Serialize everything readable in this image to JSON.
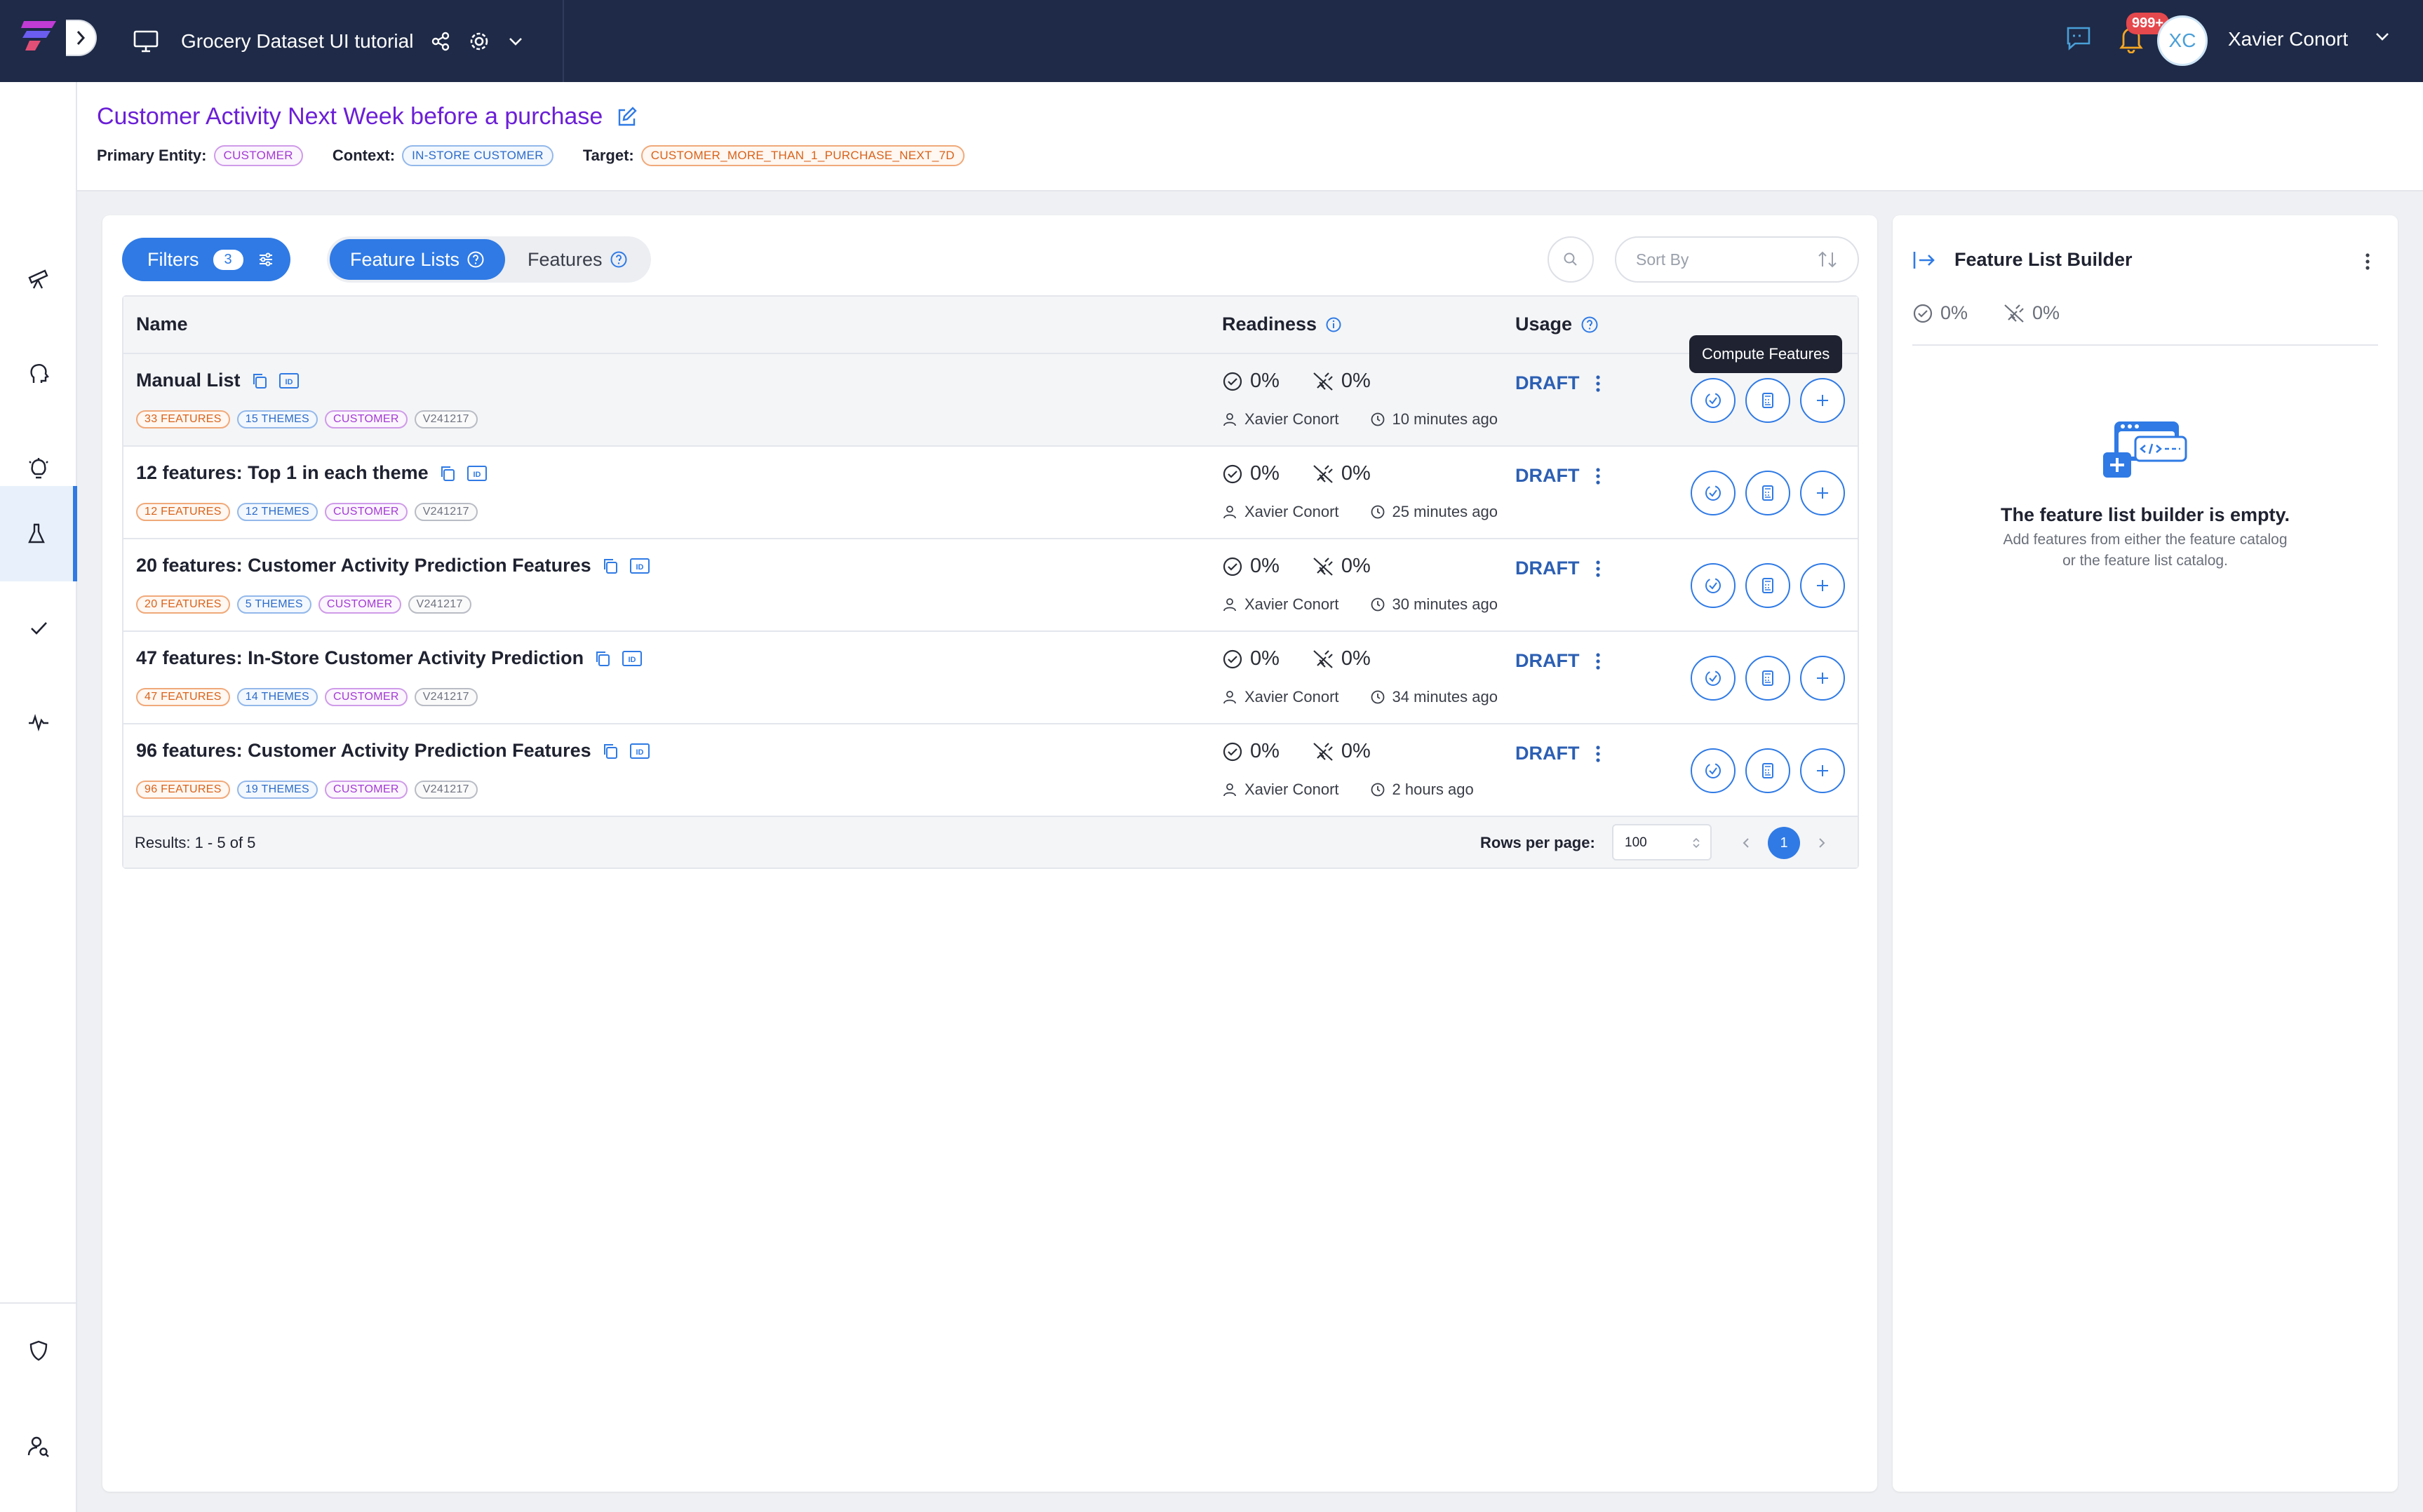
{
  "topbar": {
    "project_title": "Grocery Dataset UI tutorial",
    "notification_count": "999+",
    "avatar_initials": "XC",
    "user_name": "Xavier Conort"
  },
  "page": {
    "title": "Customer Activity Next Week before a purchase",
    "primary_entity_label": "Primary Entity:",
    "primary_entity": "CUSTOMER",
    "context_label": "Context:",
    "context": "IN-STORE CUSTOMER",
    "target_label": "Target:",
    "target": "CUSTOMER_MORE_THAN_1_PURCHASE_NEXT_7D"
  },
  "toolbar": {
    "filters_label": "Filters",
    "filters_count": "3",
    "tab_feature_lists": "Feature Lists",
    "tab_features": "Features",
    "sort_placeholder": "Sort By"
  },
  "table": {
    "col_name": "Name",
    "col_readiness": "Readiness",
    "col_usage": "Usage",
    "rows": [
      {
        "name": "Manual List",
        "features": "33 FEATURES",
        "themes": "15 THEMES",
        "entity": "CUSTOMER",
        "version": "V241217",
        "ready_pct": "0%",
        "online_pct": "0%",
        "owner": "Xavier Conort",
        "time": "10 minutes ago",
        "status": "DRAFT"
      },
      {
        "name": "12 features: Top 1 in each theme",
        "features": "12 FEATURES",
        "themes": "12 THEMES",
        "entity": "CUSTOMER",
        "version": "V241217",
        "ready_pct": "0%",
        "online_pct": "0%",
        "owner": "Xavier Conort",
        "time": "25 minutes ago",
        "status": "DRAFT"
      },
      {
        "name": "20 features: Customer Activity Prediction Features",
        "features": "20 FEATURES",
        "themes": "5 THEMES",
        "entity": "CUSTOMER",
        "version": "V241217",
        "ready_pct": "0%",
        "online_pct": "0%",
        "owner": "Xavier Conort",
        "time": "30 minutes ago",
        "status": "DRAFT"
      },
      {
        "name": "47 features: In-Store Customer Activity Prediction",
        "features": "47 FEATURES",
        "themes": "14 THEMES",
        "entity": "CUSTOMER",
        "version": "V241217",
        "ready_pct": "0%",
        "online_pct": "0%",
        "owner": "Xavier Conort",
        "time": "34 minutes ago",
        "status": "DRAFT"
      },
      {
        "name": "96 features: Customer Activity Prediction Features",
        "features": "96 FEATURES",
        "themes": "19 THEMES",
        "entity": "CUSTOMER",
        "version": "V241217",
        "ready_pct": "0%",
        "online_pct": "0%",
        "owner": "Xavier Conort",
        "time": "2 hours ago",
        "status": "DRAFT"
      }
    ],
    "results": "Results: 1 - 5 of 5",
    "rows_per_page_label": "Rows per page:",
    "rows_per_page": "100",
    "current_page": "1",
    "tooltip": "Compute Features"
  },
  "builder": {
    "title": "Feature List Builder",
    "ready_pct": "0%",
    "online_pct": "0%",
    "empty_title": "The feature list builder is empty.",
    "empty_line1": "Add features from either the feature catalog",
    "empty_line2": "or the feature list catalog."
  },
  "colors": {
    "topbar": "#1e2a47",
    "accent": "#2f7ae5",
    "title": "#6b1fd6",
    "draft": "#2c5fb3"
  }
}
